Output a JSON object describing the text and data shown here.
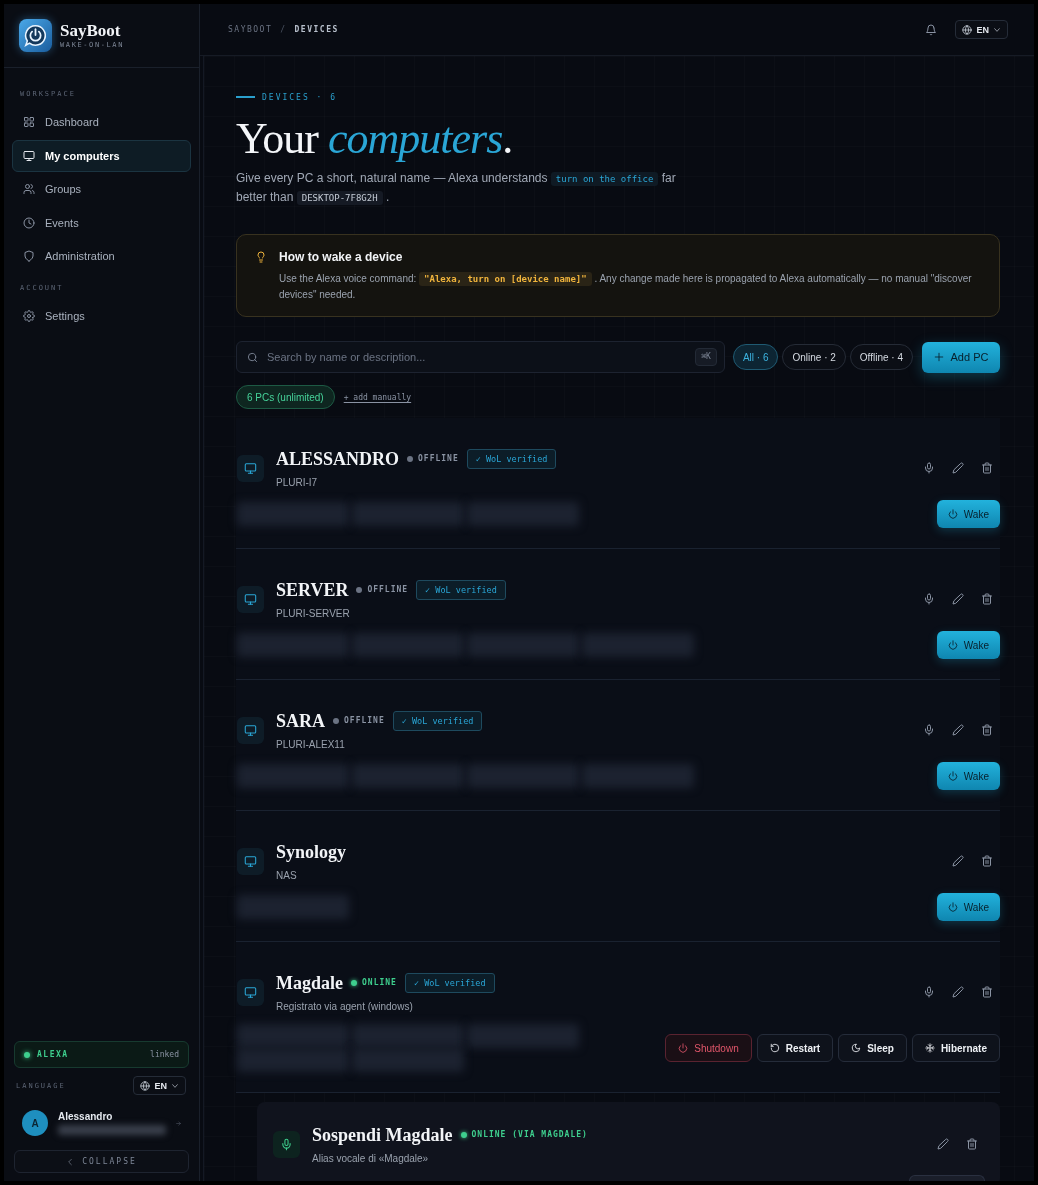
{
  "sidebar": {
    "brand": {
      "name": "SayBoot",
      "tagline": "WAKE-ON-LAN"
    },
    "sections": [
      {
        "label": "WORKSPACE",
        "items": [
          {
            "kind": "dashboard",
            "label": "Dashboard",
            "selected": false
          },
          {
            "kind": "computers",
            "label": "My computers",
            "selected": true
          },
          {
            "kind": "groups",
            "label": "Groups",
            "selected": false
          },
          {
            "kind": "events",
            "label": "Events",
            "selected": false
          },
          {
            "kind": "administration",
            "label": "Administration",
            "selected": false
          }
        ]
      },
      {
        "label": "ACCOUNT",
        "items": [
          {
            "kind": "settings",
            "label": "Settings",
            "selected": false
          }
        ]
      }
    ],
    "alexa": {
      "label": "ALEXA",
      "state": "linked",
      "connected": true
    },
    "language": {
      "label": "LANGUAGE",
      "value": "EN"
    },
    "user": {
      "initial": "A",
      "name": "Alessandro"
    },
    "collapse": {
      "label": "COLLAPSE"
    }
  },
  "header": {
    "breadcrumb": [
      {
        "label": "SAYBOOT",
        "current": false
      },
      {
        "label": "DEVICES",
        "current": true
      }
    ],
    "separator": "/",
    "language": "EN"
  },
  "hero": {
    "eyebrow": "DEVICES · 6",
    "title": "Your *computers*.",
    "intro": [
      {
        "kind": "text",
        "text": "Give every PC a short, natural name — Alexa understands "
      },
      {
        "kind": "highlight",
        "text": "turn on the office"
      },
      {
        "kind": "text",
        "text": " far better than "
      },
      {
        "kind": "code",
        "text": "DESKTOP-7F8G2H"
      },
      {
        "kind": "text",
        "text": " ."
      }
    ]
  },
  "tip": {
    "title": "How to wake a device",
    "body": [
      {
        "kind": "text",
        "text": "Use the Alexa voice command: "
      },
      {
        "kind": "command",
        "text": "\"Alexa, turn on [device name]\""
      },
      {
        "kind": "text",
        "text": " . Any change made here is propagated to Alexa automatically — no manual \"discover devices\" needed."
      }
    ]
  },
  "toolbar": {
    "search": {
      "placeholder": "Search by name or description...",
      "shortcut": "⌘K"
    },
    "filters": [
      {
        "label": "All · 6",
        "selected": true
      },
      {
        "label": "Online · 2",
        "selected": false
      },
      {
        "label": "Offline · 4",
        "selected": false
      }
    ],
    "add_button": "Add PC"
  },
  "quota": {
    "label": "6 PCs (unlimited)",
    "add_manually": "+ add manually"
  },
  "devices": [
    {
      "kind": "computer",
      "name": "ALESSANDRO",
      "online": false,
      "status_label": "OFFLINE",
      "wol_verified": true,
      "wol_label": "✓ WoL verified",
      "subtitle": "PLURI-I7",
      "voice_button": true,
      "details": [
        {
          "kind": "blurred"
        },
        {
          "kind": "blurred"
        },
        {
          "kind": "blurred"
        }
      ],
      "actions": [
        {
          "kind": "wake",
          "label": "Wake"
        }
      ]
    },
    {
      "kind": "computer",
      "name": "SERVER",
      "online": false,
      "status_label": "OFFLINE",
      "wol_verified": true,
      "wol_label": "✓ WoL verified",
      "subtitle": "PLURI-SERVER",
      "voice_button": true,
      "details": [
        {
          "kind": "blurred"
        },
        {
          "kind": "blurred"
        },
        {
          "kind": "blurred"
        },
        {
          "kind": "blurred"
        }
      ],
      "actions": [
        {
          "kind": "wake",
          "label": "Wake"
        }
      ]
    },
    {
      "kind": "computer",
      "name": "SARA",
      "online": false,
      "status_label": "OFFLINE",
      "wol_verified": true,
      "wol_label": "✓ WoL verified",
      "subtitle": "PLURI-ALEX11",
      "voice_button": true,
      "details": [
        {
          "kind": "blurred"
        },
        {
          "kind": "blurred"
        },
        {
          "kind": "blurred"
        },
        {
          "kind": "blurred"
        }
      ],
      "actions": [
        {
          "kind": "wake",
          "label": "Wake"
        }
      ]
    },
    {
      "kind": "computer",
      "name": "Synology",
      "wol_verified": false,
      "subtitle": "NAS",
      "voice_button": false,
      "details": [
        {
          "kind": "blurred"
        }
      ],
      "actions": [
        {
          "kind": "wake",
          "label": "Wake"
        }
      ]
    },
    {
      "kind": "computer",
      "name": "Magdale",
      "online": true,
      "status_label": "ONLINE",
      "wol_verified": true,
      "wol_label": "✓ WoL verified",
      "subtitle": "Registrato via agent (windows)",
      "voice_button": true,
      "details": [
        {
          "kind": "blurred"
        },
        {
          "kind": "blurred"
        },
        {
          "kind": "blurred"
        },
        {
          "kind": "blurred"
        },
        {
          "kind": "blurred"
        }
      ],
      "actions": [
        {
          "kind": "shutdown",
          "label": "Shutdown"
        },
        {
          "kind": "restart",
          "label": "Restart"
        },
        {
          "kind": "sleep",
          "label": "Sleep"
        },
        {
          "kind": "hibernate",
          "label": "Hibernate"
        }
      ],
      "aliases": [
        {
          "kind": "alias",
          "name": "Sospendi Magdale",
          "online": true,
          "status_label": "ONLINE (VIA MAGDALE)",
          "subtitle": "Alias vocale di «Magdale»",
          "voice_button": false,
          "actions": [
            {
              "kind": "cut"
            }
          ]
        }
      ]
    }
  ]
}
